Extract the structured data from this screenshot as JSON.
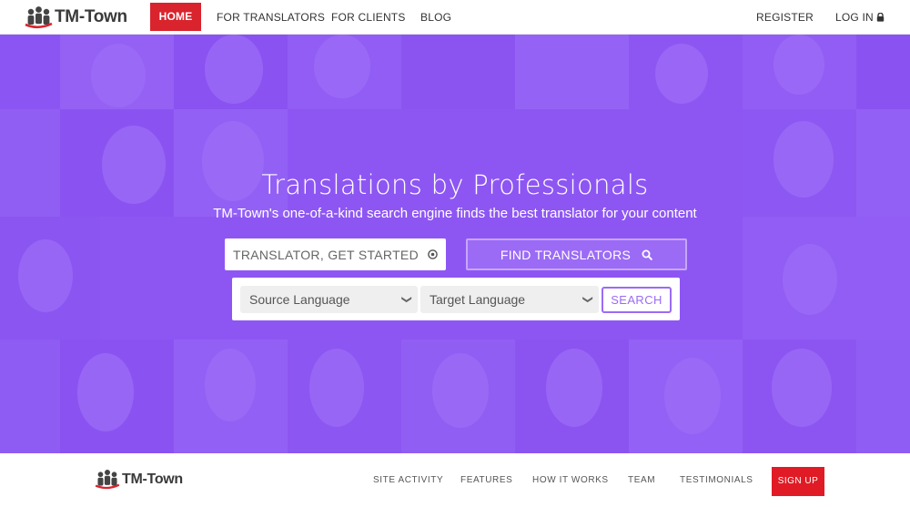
{
  "brand": {
    "name": "TM-Town",
    "accent": "#d9232d",
    "hero_color": "#8f58f2"
  },
  "nav": {
    "home": "HOME",
    "for_translators": "FOR TRANSLATORS",
    "for_clients": "FOR CLIENTS",
    "blog": "BLOG",
    "register": "REGISTER",
    "log_in": "LOG IN"
  },
  "hero": {
    "title": "Translations by Professionals",
    "subtitle": "TM-Town's one-of-a-kind search engine finds the best translator for your content",
    "translator_button": "TRANSLATOR, GET STARTED",
    "find_button": "FIND TRANSLATORS"
  },
  "search": {
    "source_language": "Source Language",
    "target_language": "Target Language",
    "search_button": "SEARCH"
  },
  "footer": {
    "site_activity": "SITE ACTIVITY",
    "features": "FEATURES",
    "how_it_works": "HOW IT WORKS",
    "team": "TEAM",
    "testimonials": "TESTIMONIALS",
    "sign_up": "SIGN UP"
  },
  "icons": {
    "logo": "people-group-icon",
    "lock": "lock-icon",
    "translator": "arrow-circle-icon",
    "find": "search-icon",
    "dropdown": "chevron-down-icon"
  }
}
